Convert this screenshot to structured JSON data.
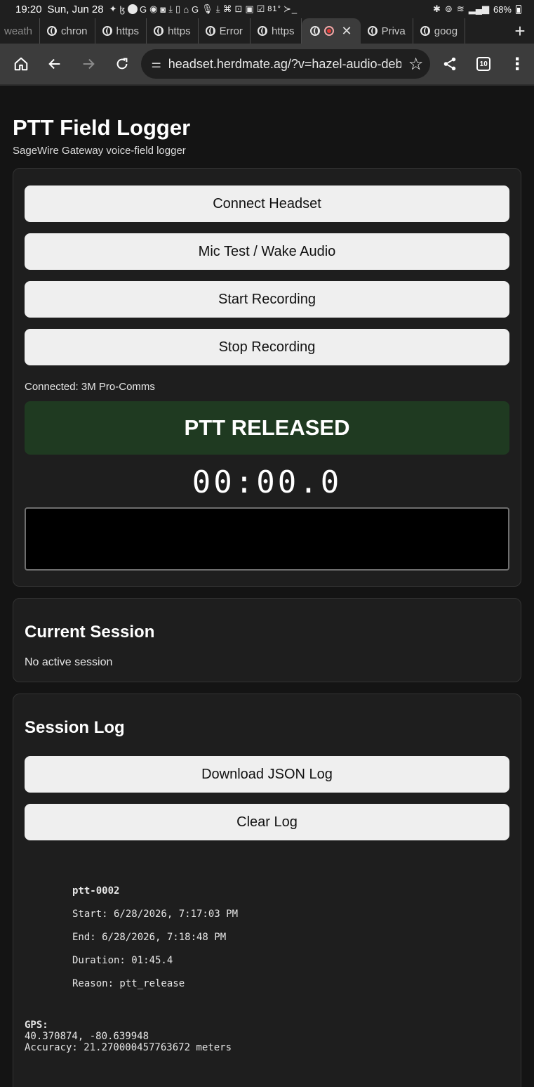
{
  "status_bar": {
    "time": "19:20",
    "date": "Sun, Jun 28",
    "temperature": "81°",
    "battery": "68%"
  },
  "tabs": [
    {
      "label": "weath",
      "active": false
    },
    {
      "label": "chron",
      "active": false
    },
    {
      "label": "https",
      "active": false
    },
    {
      "label": "https",
      "active": false
    },
    {
      "label": "Error",
      "active": false
    },
    {
      "label": "https",
      "active": false
    },
    {
      "label": "",
      "active": true
    },
    {
      "label": "Priva",
      "active": false
    },
    {
      "label": "goog",
      "active": false
    }
  ],
  "toolbar": {
    "url": "headset.herdmate.ag/?v=hazel-audio-deb",
    "tab_count": "10"
  },
  "header": {
    "title": "PTT Field Logger",
    "subtitle": "SageWire Gateway voice-field logger"
  },
  "controls": {
    "connect_label": "Connect Headset",
    "mic_test_label": "Mic Test / Wake Audio",
    "start_label": "Start Recording",
    "stop_label": "Stop Recording",
    "connection_status": "Connected: 3M Pro-Comms",
    "ptt_state": "PTT RELEASED",
    "timer": "00:00.0"
  },
  "current_session": {
    "title": "Current Session",
    "status": "No active session"
  },
  "session_log": {
    "title": "Session Log",
    "download_label": "Download JSON Log",
    "clear_label": "Clear Log",
    "entries": [
      {
        "id": "ptt-0002",
        "start": "Start: 6/28/2026, 7:17:03 PM",
        "end": "End: 6/28/2026, 7:18:48 PM",
        "duration": "Duration: 01:45.4",
        "reason": "Reason: ptt_release",
        "gps_label": "GPS:",
        "gps_coords": "40.370874, -80.639948",
        "gps_accuracy": "Accuracy: 21.270000457763672 meters"
      }
    ]
  },
  "colors": {
    "page_bg": "#141414",
    "card_bg": "#1e1e1e",
    "ptt_released_bg": "#1f3a21",
    "button_bg": "#efefef"
  }
}
